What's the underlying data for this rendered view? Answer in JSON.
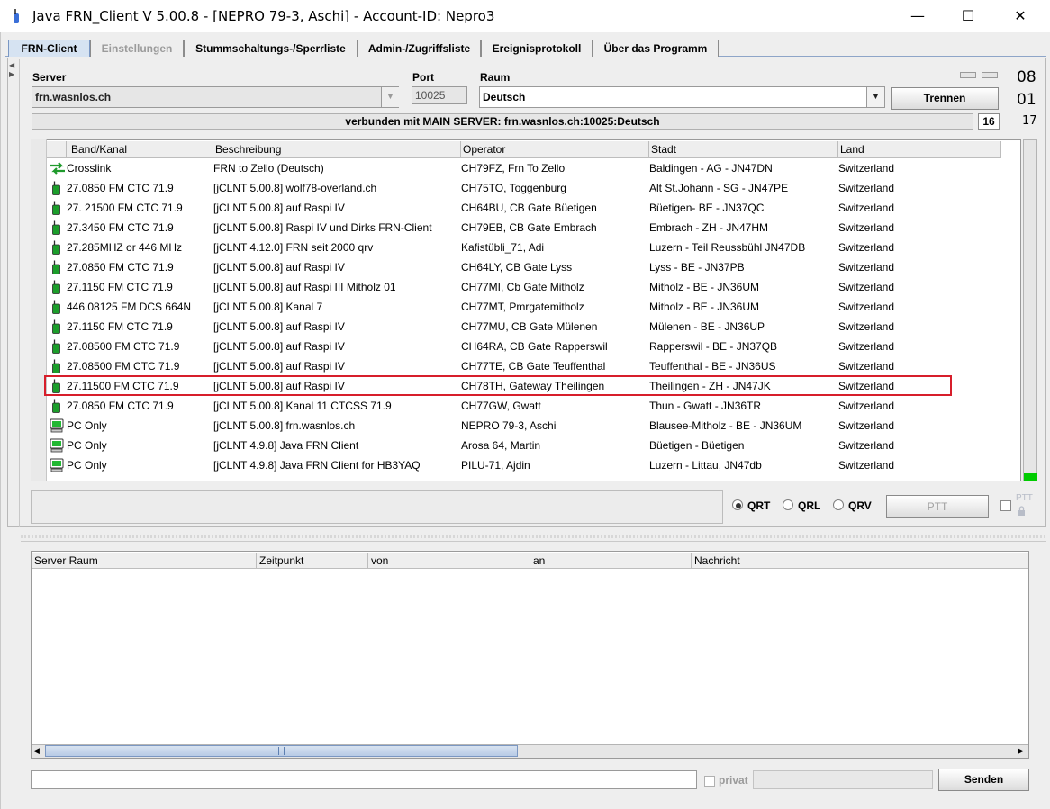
{
  "window": {
    "title": "Java FRN_Client V 5.00.8 - [NEPRO 79-3, Aschi] - Account-ID: Nepro3",
    "minimize": "—",
    "maximize": "☐",
    "close": "✕"
  },
  "tabs": [
    {
      "label": "FRN-Client",
      "state": "active"
    },
    {
      "label": "Einstellungen",
      "state": "disabled"
    },
    {
      "label": "Stummschaltungs-/Sperrliste",
      "state": "normal"
    },
    {
      "label": "Admin-/Zugriffsliste",
      "state": "normal"
    },
    {
      "label": "Ereignisprotokoll",
      "state": "normal"
    },
    {
      "label": "Über das Programm",
      "state": "normal"
    }
  ],
  "connection": {
    "server_label": "Server",
    "server_value": "frn.wasnlos.ch",
    "port_label": "Port",
    "port_value": "10025",
    "room_label": "Raum",
    "room_value": "Deutsch",
    "disconnect_button": "Trennen",
    "status_text": "verbunden mit  MAIN SERVER: frn.wasnlos.ch:10025:Deutsch",
    "count_box": "16",
    "side_numbers": [
      "08",
      "01",
      "17"
    ]
  },
  "users_table": {
    "columns": [
      "Band/Kanal",
      "Beschreibung",
      "Operator",
      "Stadt",
      "Land"
    ],
    "rows": [
      {
        "icon": "crosslink-icon",
        "band": "Crosslink",
        "desc": "FRN to Zello (Deutsch)",
        "operator": "CH79FZ, Frn To Zello",
        "city": "Baldingen - AG - JN47DN",
        "country": "Switzerland"
      },
      {
        "icon": "radio-gateway-icon",
        "band": "27.0850 FM CTC 71.9",
        "desc": "[jCLNT 5.00.8] wolf78-overland.ch",
        "operator": "CH75TO, Toggenburg",
        "city": "Alt St.Johann - SG - JN47PE",
        "country": "Switzerland"
      },
      {
        "icon": "radio-gateway-icon",
        "band": "27. 21500 FM CTC 71.9",
        "desc": "[jCLNT 5.00.8] auf Raspi IV",
        "operator": "CH64BU, CB Gate Büetigen",
        "city": "Büetigen- BE - JN37QC",
        "country": "Switzerland"
      },
      {
        "icon": "radio-gateway-icon",
        "band": "27.3450 FM CTC 71.9",
        "desc": "[jCLNT 5.00.8] Raspi IV und Dirks FRN-Client",
        "operator": "CH79EB, CB Gate Embrach",
        "city": "Embrach - ZH - JN47HM",
        "country": "Switzerland"
      },
      {
        "icon": "radio-gateway-icon",
        "band": "27.285MHZ or 446 MHz",
        "desc": "[jCLNT 4.12.0] FRN seit 2000 qrv",
        "operator": "Kafistübli_71, Adi",
        "city": "Luzern - Teil Reussbühl JN47DB",
        "country": "Switzerland"
      },
      {
        "icon": "radio-gateway-icon",
        "band": "27.0850 FM CTC 71.9",
        "desc": "[jCLNT 5.00.8] auf Raspi IV",
        "operator": "CH64LY, CB Gate Lyss",
        "city": "Lyss - BE - JN37PB",
        "country": "Switzerland"
      },
      {
        "icon": "radio-gateway-icon",
        "band": "27.1150 FM CTC 71.9",
        "desc": "[jCLNT 5.00.8] auf Raspi III  Mitholz 01",
        "operator": "CH77MI, Cb Gate Mitholz",
        "city": "Mitholz - BE - JN36UM",
        "country": "Switzerland"
      },
      {
        "icon": "radio-gateway-icon",
        "band": "446.08125 FM DCS 664N",
        "desc": "[jCLNT 5.00.8] Kanal 7",
        "operator": "CH77MT, Pmrgatemitholz",
        "city": "Mitholz - BE - JN36UM",
        "country": "Switzerland"
      },
      {
        "icon": "radio-gateway-icon",
        "band": "27.1150 FM CTC 71.9",
        "desc": "[jCLNT 5.00.8] auf Raspi IV",
        "operator": "CH77MU, CB Gate Mülenen",
        "city": "Mülenen - BE - JN36UP",
        "country": "Switzerland"
      },
      {
        "icon": "radio-gateway-icon",
        "band": "27.08500 FM CTC 71.9",
        "desc": "[jCLNT 5.00.8] auf Raspi IV",
        "operator": "CH64RA, CB Gate Rapperswil",
        "city": "Rapperswil - BE - JN37QB",
        "country": "Switzerland"
      },
      {
        "icon": "radio-gateway-icon",
        "band": "27.08500 FM CTC 71.9",
        "desc": "[jCLNT 5.00.8] auf Raspi IV",
        "operator": "CH77TE, CB Gate Teuffenthal",
        "city": "Teuffenthal - BE - JN36US",
        "country": "Switzerland"
      },
      {
        "icon": "radio-gateway-icon",
        "band": "27.11500 FM CTC 71.9",
        "desc": "[jCLNT 5.00.8] auf Raspi IV",
        "operator": "CH78TH, Gateway Theilingen",
        "city": "Theilingen - ZH - JN47JK",
        "country": "Switzerland"
      },
      {
        "icon": "radio-gateway-icon",
        "band": "27.0850 FM CTC 71.9",
        "desc": "[jCLNT 5.00.8] Kanal 11 CTCSS 71.9",
        "operator": "CH77GW, Gwatt",
        "city": "Thun - Gwatt - JN36TR",
        "country": "Switzerland"
      },
      {
        "icon": "pc-monitor-icon",
        "band": "PC Only",
        "desc": "[jCLNT 5.00.8] frn.wasnlos.ch",
        "operator": "NEPRO 79-3, Aschi",
        "city": "Blausee-Mitholz - BE - JN36UM",
        "country": "Switzerland"
      },
      {
        "icon": "pc-monitor-icon",
        "band": "PC Only",
        "desc": "[jCLNT 4.9.8] Java FRN Client",
        "operator": "Arosa 64, Martin",
        "city": "Büetigen - Büetigen",
        "country": "Switzerland"
      },
      {
        "icon": "pc-monitor-icon",
        "band": "PC Only",
        "desc": "[jCLNT 4.9.8] Java FRN Client for HB3YAQ",
        "operator": "PILU-71, Ajdin",
        "city": "Luzern - Littau, JN47db",
        "country": "Switzerland"
      }
    ]
  },
  "ptt": {
    "radios": [
      {
        "label": "QRT",
        "selected": true
      },
      {
        "label": "QRL",
        "selected": false
      },
      {
        "label": "QRV",
        "selected": false
      }
    ],
    "ptt_button": "PTT",
    "ptt_lock_label": "PTT"
  },
  "messages": {
    "columns": [
      "Server Raum",
      "Zeitpunkt",
      "von",
      "an",
      "Nachricht"
    ],
    "input_value": "",
    "private_label": "privat",
    "send_button": "Senden"
  },
  "colors": {
    "highlight": "#d71e2b",
    "active_tab": "#d6e3f2",
    "led_green": "#00cc00"
  }
}
